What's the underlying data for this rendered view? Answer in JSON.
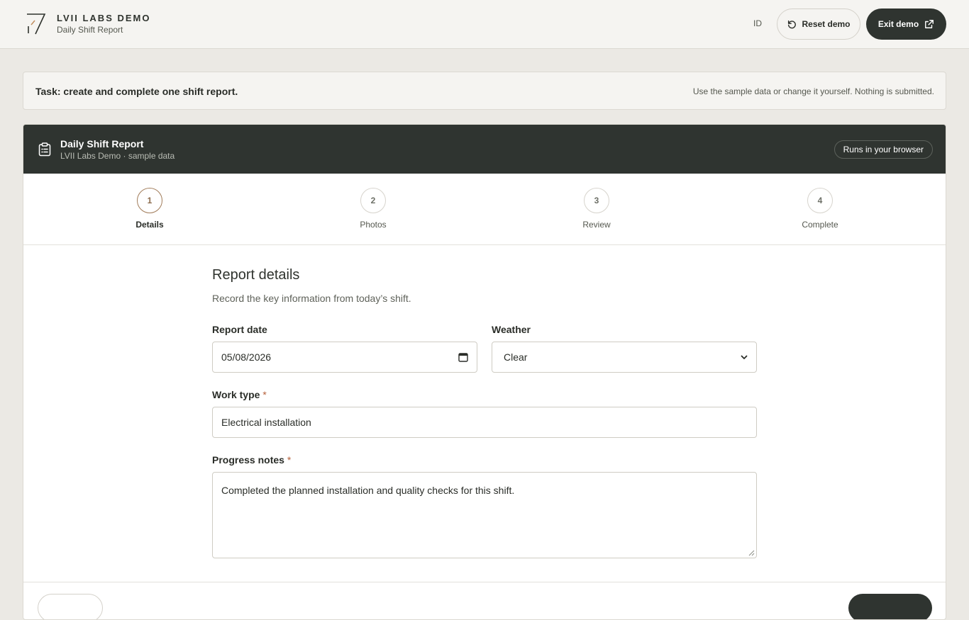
{
  "header": {
    "brand_name": "LVII LABS DEMO",
    "brand_sub": "Daily Shift Report",
    "lang": "ID",
    "reset_label": "Reset demo",
    "exit_label": "Exit demo"
  },
  "task": {
    "title": "Task: create and complete one shift report.",
    "note": "Use the sample data or change it yourself. Nothing is submitted."
  },
  "card": {
    "title": "Daily Shift Report",
    "subtitle": "LVII Labs Demo · sample data",
    "pill": "Runs in your browser"
  },
  "steps": [
    {
      "number": "1",
      "label": "Details",
      "active": true
    },
    {
      "number": "2",
      "label": "Photos",
      "active": false
    },
    {
      "number": "3",
      "label": "Review",
      "active": false
    },
    {
      "number": "4",
      "label": "Complete",
      "active": false
    }
  ],
  "form": {
    "title": "Report details",
    "description": "Record the key information from today’s shift.",
    "report_date_label": "Report date",
    "report_date_value": "05/08/2026",
    "weather_label": "Weather",
    "weather_value": "Clear",
    "work_type_label": "Work type",
    "work_type_value": "Electrical installation",
    "progress_label": "Progress notes",
    "progress_value": "Completed the planned installation and quality checks for this shift.",
    "required_mark": "*"
  },
  "colors": {
    "dark": "#2f3430",
    "accent": "#a17c5a",
    "required": "#b5603a",
    "background": "#ebe9e4"
  }
}
